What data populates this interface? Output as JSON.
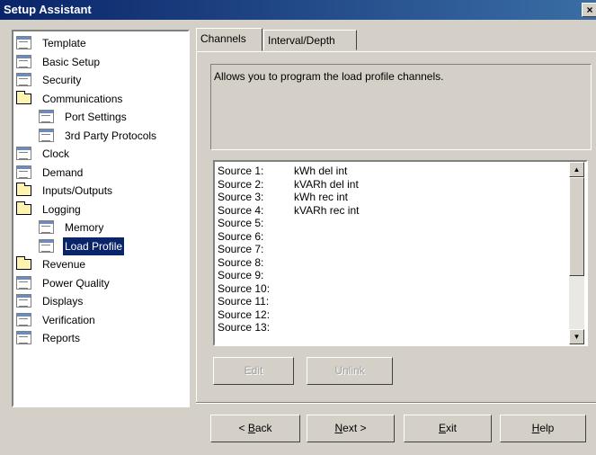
{
  "window": {
    "title": "Setup Assistant",
    "close_glyph": "×"
  },
  "tree": {
    "items": [
      {
        "label": "Template",
        "icon": "doc-icon",
        "indent": 0
      },
      {
        "label": "Basic Setup",
        "icon": "doc-icon",
        "indent": 0
      },
      {
        "label": "Security",
        "icon": "doc-icon",
        "indent": 0
      },
      {
        "label": "Communications",
        "icon": "folder-icon",
        "indent": 0
      },
      {
        "label": "Port Settings",
        "icon": "doc-icon",
        "indent": 1
      },
      {
        "label": "3rd Party Protocols",
        "icon": "doc-icon",
        "indent": 1
      },
      {
        "label": "Clock",
        "icon": "doc-icon",
        "indent": 0
      },
      {
        "label": "Demand",
        "icon": "doc-icon",
        "indent": 0
      },
      {
        "label": "Inputs/Outputs",
        "icon": "folder-icon",
        "indent": 0
      },
      {
        "label": "Logging",
        "icon": "folder-icon",
        "indent": 0
      },
      {
        "label": "Memory",
        "icon": "doc-icon",
        "indent": 1
      },
      {
        "label": "Load Profile",
        "icon": "doc-icon",
        "indent": 1,
        "selected": true
      },
      {
        "label": "Revenue",
        "icon": "folder-icon",
        "indent": 0
      },
      {
        "label": "Power Quality",
        "icon": "doc-icon",
        "indent": 0
      },
      {
        "label": "Displays",
        "icon": "doc-icon",
        "indent": 0
      },
      {
        "label": "Verification",
        "icon": "doc-icon",
        "indent": 0
      },
      {
        "label": "Reports",
        "icon": "doc-icon",
        "indent": 0
      }
    ]
  },
  "tabs": [
    {
      "label": "Channels",
      "active": true
    },
    {
      "label": "Interval/Depth",
      "active": false
    }
  ],
  "description": "Allows you to program the load profile channels.",
  "sources": [
    {
      "source": "Source 1:",
      "value": "kWh del int"
    },
    {
      "source": "Source 2:",
      "value": "kVARh del int"
    },
    {
      "source": "Source 3:",
      "value": "kWh rec int"
    },
    {
      "source": "Source 4:",
      "value": "kVARh rec int"
    },
    {
      "source": "Source 5:",
      "value": ""
    },
    {
      "source": "Source 6:",
      "value": ""
    },
    {
      "source": "Source 7:",
      "value": ""
    },
    {
      "source": "Source 8:",
      "value": ""
    },
    {
      "source": "Source 9:",
      "value": ""
    },
    {
      "source": "Source 10:",
      "value": ""
    },
    {
      "source": "Source 11:",
      "value": ""
    },
    {
      "source": "Source 12:",
      "value": ""
    },
    {
      "source": "Source 13:",
      "value": ""
    }
  ],
  "scrollbar": {
    "up_glyph": "▲",
    "down_glyph": "▼"
  },
  "actions": {
    "edit": "Edit",
    "unlink": "Unlink"
  },
  "nav": {
    "back": {
      "prefix": "< ",
      "hotkey": "B",
      "rest": "ack"
    },
    "next": {
      "hotkey": "N",
      "rest": "ext >"
    },
    "exit": {
      "hotkey": "E",
      "rest": "xit"
    },
    "help": {
      "hotkey": "H",
      "rest": "elp"
    }
  }
}
